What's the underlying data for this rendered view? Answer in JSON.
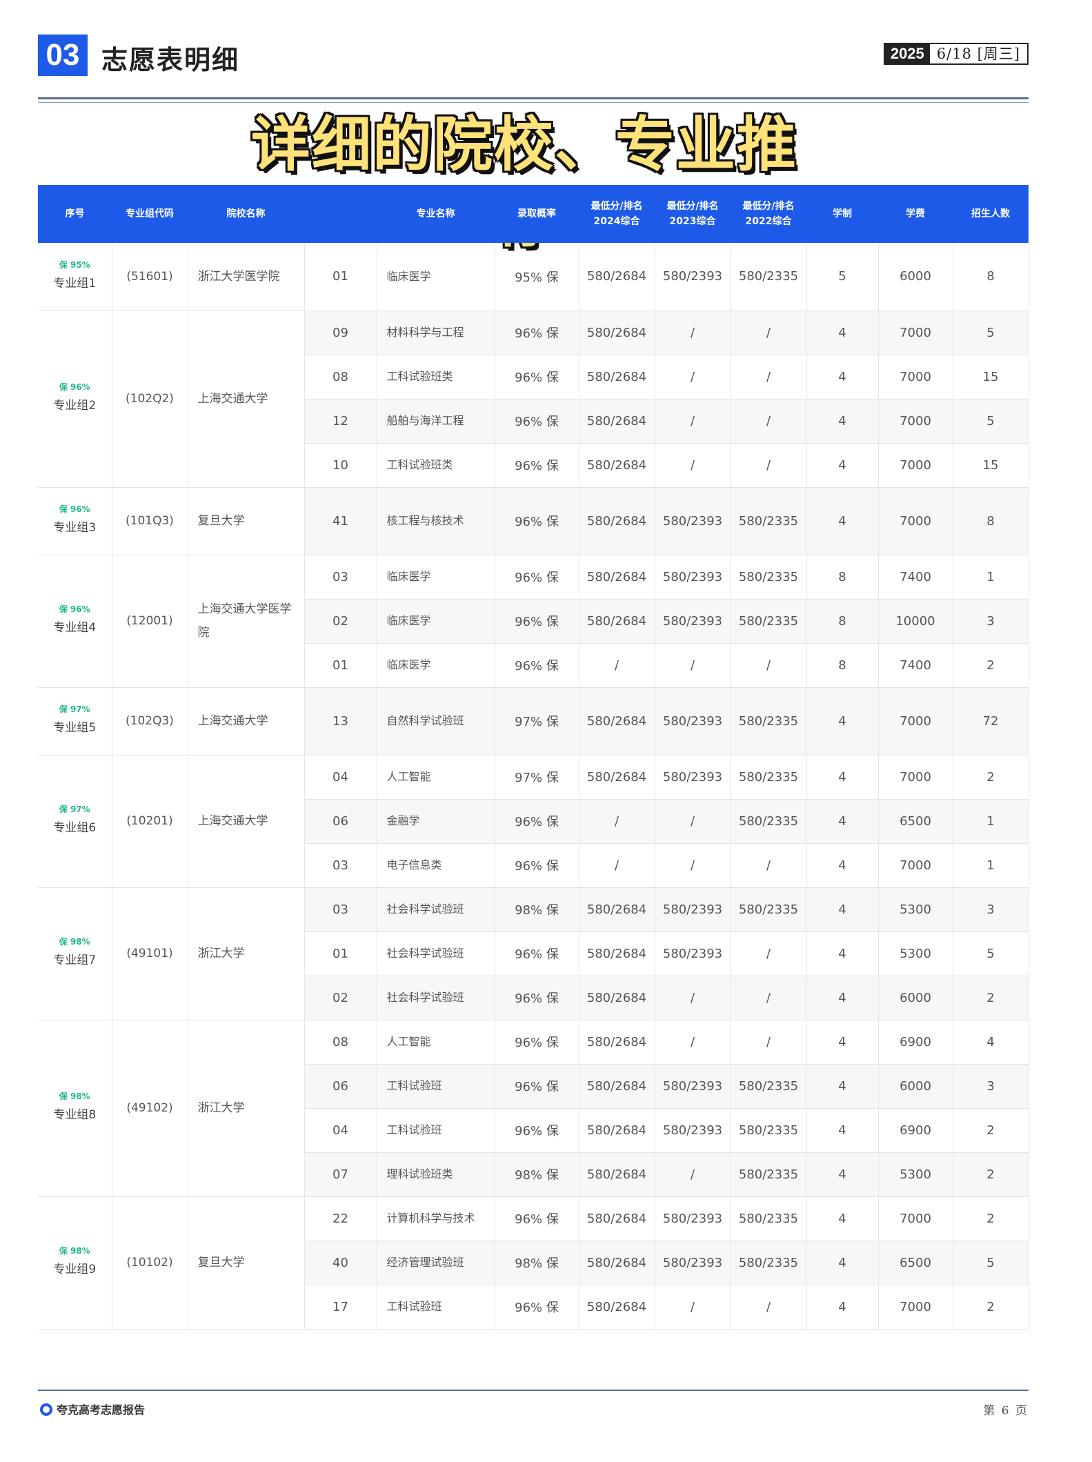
{
  "header": {
    "section_number": "03",
    "section_title": "志愿表明细",
    "year": "2025",
    "date": "6/18 [周三]"
  },
  "banner": "详细的院校、专业推荐",
  "table": {
    "columns": [
      "序号",
      "专业组代码",
      "院校名称",
      "",
      "专业名称",
      "录取概率",
      "最低分/排名 2024综合",
      "最低分/排名 2023综合",
      "最低分/排名 2022综合",
      "学制",
      "学费",
      "招生人数"
    ],
    "groups": [
      {
        "badge": "保 95%",
        "name": "专业组1",
        "code": "(51601)",
        "school": "浙江大学医学院",
        "rows": [
          [
            "01",
            "临床医学",
            "95% 保",
            "580/2684",
            "580/2393",
            "580/2335",
            "5",
            "6000",
            "8"
          ]
        ]
      },
      {
        "badge": "保 96%",
        "name": "专业组2",
        "code": "(102Q2)",
        "school": "上海交通大学",
        "rows": [
          [
            "09",
            "材料科学与工程",
            "96% 保",
            "580/2684",
            "/",
            "/",
            "4",
            "7000",
            "5"
          ],
          [
            "08",
            "工科试验班类",
            "96% 保",
            "580/2684",
            "/",
            "/",
            "4",
            "7000",
            "15"
          ],
          [
            "12",
            "船舶与海洋工程",
            "96% 保",
            "580/2684",
            "/",
            "/",
            "4",
            "7000",
            "5"
          ],
          [
            "10",
            "工科试验班类",
            "96% 保",
            "580/2684",
            "/",
            "/",
            "4",
            "7000",
            "15"
          ]
        ]
      },
      {
        "badge": "保 96%",
        "name": "专业组3",
        "code": "(101Q3)",
        "school": "复旦大学",
        "rows": [
          [
            "41",
            "核工程与核技术",
            "96% 保",
            "580/2684",
            "580/2393",
            "580/2335",
            "4",
            "7000",
            "8"
          ]
        ]
      },
      {
        "badge": "保 96%",
        "name": "专业组4",
        "code": "(12001)",
        "school": "上海交通大学医学院",
        "rows": [
          [
            "03",
            "临床医学",
            "96% 保",
            "580/2684",
            "580/2393",
            "580/2335",
            "8",
            "7400",
            "1"
          ],
          [
            "02",
            "临床医学",
            "96% 保",
            "580/2684",
            "580/2393",
            "580/2335",
            "8",
            "10000",
            "3"
          ],
          [
            "01",
            "临床医学",
            "96% 保",
            "/",
            "/",
            "/",
            "8",
            "7400",
            "2"
          ]
        ]
      },
      {
        "badge": "保 97%",
        "name": "专业组5",
        "code": "(102Q3)",
        "school": "上海交通大学",
        "rows": [
          [
            "13",
            "自然科学试验班",
            "97% 保",
            "580/2684",
            "580/2393",
            "580/2335",
            "4",
            "7000",
            "72"
          ]
        ]
      },
      {
        "badge": "保 97%",
        "name": "专业组6",
        "code": "(10201)",
        "school": "上海交通大学",
        "rows": [
          [
            "04",
            "人工智能",
            "97% 保",
            "580/2684",
            "580/2393",
            "580/2335",
            "4",
            "7000",
            "2"
          ],
          [
            "06",
            "金融学",
            "96% 保",
            "/",
            "/",
            "580/2335",
            "4",
            "6500",
            "1"
          ],
          [
            "03",
            "电子信息类",
            "96% 保",
            "/",
            "/",
            "/",
            "4",
            "7000",
            "1"
          ]
        ]
      },
      {
        "badge": "保 98%",
        "name": "专业组7",
        "code": "(49101)",
        "school": "浙江大学",
        "rows": [
          [
            "03",
            "社会科学试验班",
            "98% 保",
            "580/2684",
            "580/2393",
            "580/2335",
            "4",
            "5300",
            "3"
          ],
          [
            "01",
            "社会科学试验班",
            "96% 保",
            "580/2684",
            "580/2393",
            "/",
            "4",
            "5300",
            "5"
          ],
          [
            "02",
            "社会科学试验班",
            "96% 保",
            "580/2684",
            "/",
            "/",
            "4",
            "6000",
            "2"
          ]
        ]
      },
      {
        "badge": "保 98%",
        "name": "专业组8",
        "code": "(49102)",
        "school": "浙江大学",
        "rows": [
          [
            "08",
            "人工智能",
            "96% 保",
            "580/2684",
            "/",
            "/",
            "4",
            "6900",
            "4"
          ],
          [
            "06",
            "工科试验班",
            "96% 保",
            "580/2684",
            "580/2393",
            "580/2335",
            "4",
            "6000",
            "3"
          ],
          [
            "04",
            "工科试验班",
            "96% 保",
            "580/2684",
            "580/2393",
            "580/2335",
            "4",
            "6900",
            "2"
          ],
          [
            "07",
            "理科试验班类",
            "98% 保",
            "580/2684",
            "/",
            "580/2335",
            "4",
            "5300",
            "2"
          ]
        ]
      },
      {
        "badge": "保 98%",
        "name": "专业组9",
        "code": "(10102)",
        "school": "复旦大学",
        "rows": [
          [
            "22",
            "计算机科学与技术",
            "96% 保",
            "580/2684",
            "580/2393",
            "580/2335",
            "4",
            "7000",
            "2"
          ],
          [
            "40",
            "经济管理试验班",
            "98% 保",
            "580/2684",
            "580/2393",
            "580/2335",
            "4",
            "6500",
            "5"
          ],
          [
            "17",
            "工科试验班",
            "96% 保",
            "580/2684",
            "/",
            "/",
            "4",
            "7000",
            "2"
          ]
        ]
      }
    ]
  },
  "footer": {
    "brand": "夸克高考志愿报告",
    "page": "第 6 页"
  }
}
